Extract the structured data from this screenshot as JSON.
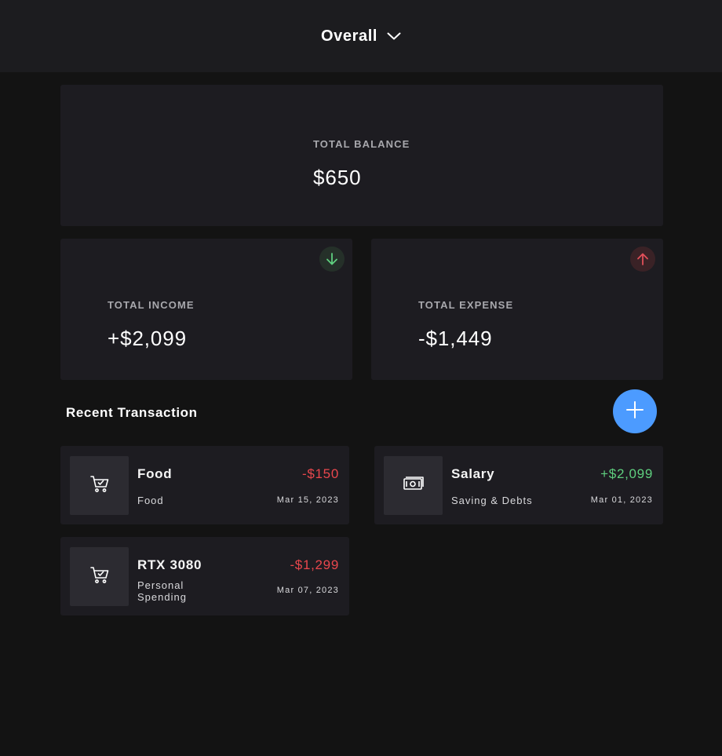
{
  "header": {
    "period_label": "Overall",
    "dropdown_icon": "chevron-down-icon"
  },
  "balance": {
    "label": "TOTAL BALANCE",
    "amount": "$650"
  },
  "income": {
    "label": "TOTAL INCOME",
    "amount": "+$2,099",
    "icon": "arrow-down-icon",
    "color": "#5fcf7f"
  },
  "expense": {
    "label": "TOTAL EXPENSE",
    "amount": "-$1,449",
    "icon": "arrow-up-icon",
    "color": "#e0505a"
  },
  "transactions": {
    "title": "Recent Transaction",
    "add_icon": "plus-icon",
    "accent": "#4c9bff",
    "items": [
      {
        "name": "Food",
        "category": "Food",
        "amount": "-$150",
        "date": "Mar 15, 2023",
        "icon": "shopping-cart-icon",
        "color": "#e9474d"
      },
      {
        "name": "Salary",
        "category": "Saving & Debts",
        "amount": "+$2,099",
        "date": "Mar 01, 2023",
        "icon": "money-bill-icon",
        "color": "#5fcf7f"
      },
      {
        "name": "RTX 3080",
        "category": "Personal Spending",
        "amount": "-$1,299",
        "date": "Mar 07, 2023",
        "icon": "shopping-cart-icon",
        "color": "#e9474d"
      }
    ]
  }
}
